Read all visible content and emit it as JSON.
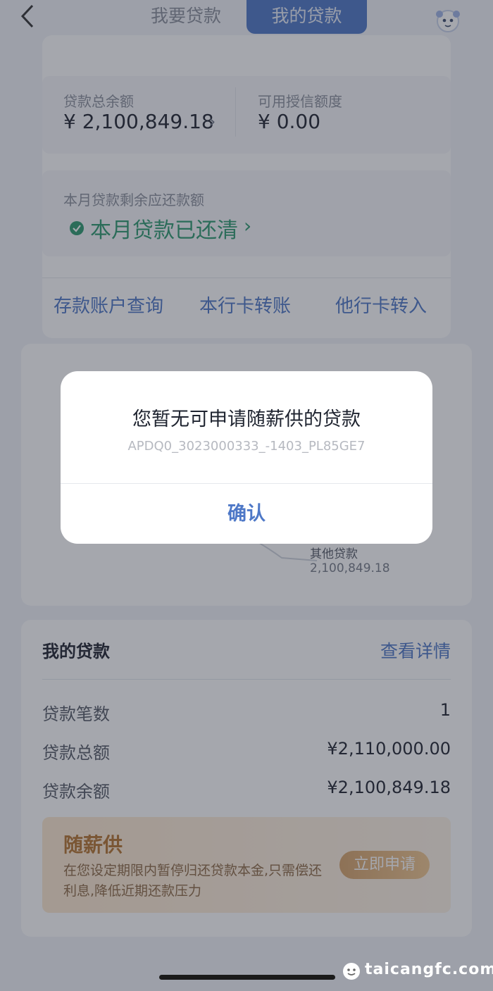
{
  "nav": {
    "tab_apply": "我要贷款",
    "tab_mine": "我的贷款"
  },
  "summary": {
    "total_balance_label": "贷款总余额",
    "total_balance": "¥ 2,100,849.18",
    "available_credit_label": "可用授信额度",
    "available_credit": "¥ 0.00",
    "chevron": "›"
  },
  "repay": {
    "label": "本月贷款剩余应还款额",
    "status": "本月贷款已还清",
    "chevron": "›"
  },
  "quick_links": [
    "存款账户查询",
    "本行卡转账",
    "他行卡转入"
  ],
  "chart_fragment": {
    "label": "其他贷款",
    "value": "2,100,849.18"
  },
  "my_loans": {
    "title": "我的贷款",
    "detail_link": "查看详情",
    "rows": [
      {
        "label": "贷款笔数",
        "value": "1"
      },
      {
        "label": "贷款总额",
        "value": "¥2,110,000.00"
      },
      {
        "label": "贷款余额",
        "value": "¥2,100,849.18"
      }
    ]
  },
  "promo": {
    "title": "随薪供",
    "description": "在您设定期限内暂停归还贷款本金,只需偿还利息,降低近期还款压力",
    "button": "立即申请"
  },
  "dialog": {
    "title": "您暂无可申请随薪供的贷款",
    "code": "APDQ0_3023000333_-1403_PL85GE7",
    "confirm": "确认"
  },
  "watermark": {
    "text": "taicangfc.com"
  },
  "colors": {
    "accent": "#4e78c7",
    "success": "#2e9a6f",
    "promo": "#b5742f"
  }
}
